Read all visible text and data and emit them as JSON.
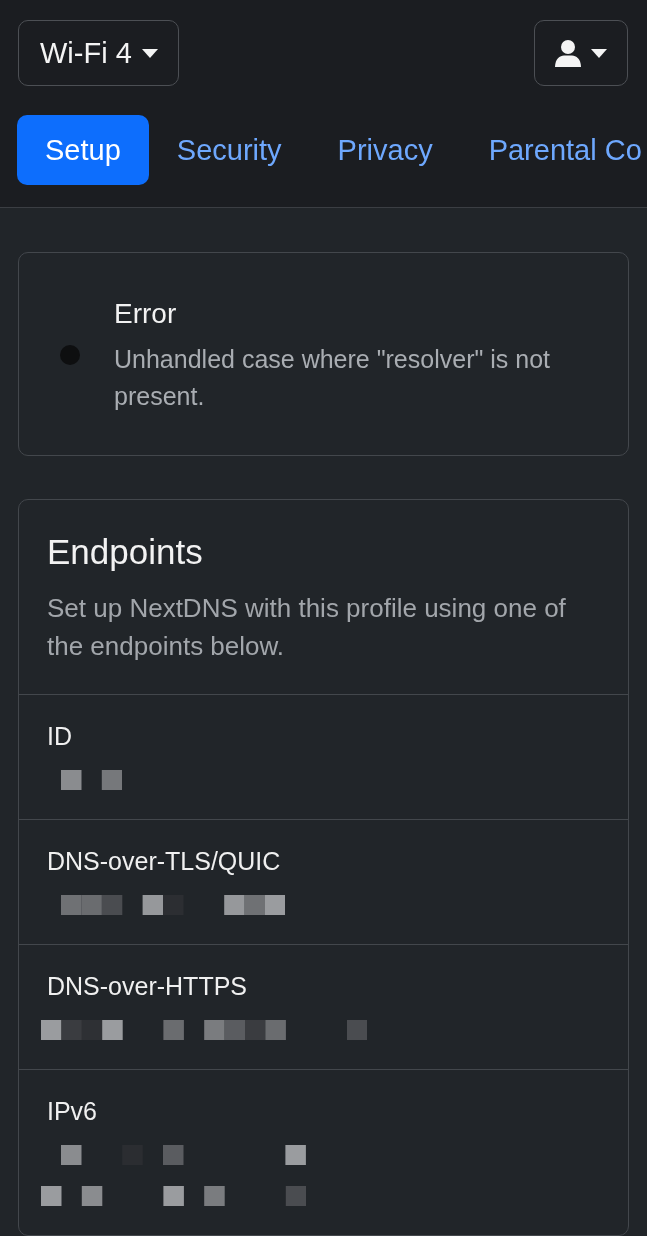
{
  "profile_menu": {
    "label": "Wi-Fi 4"
  },
  "tabs": [
    {
      "label": "Setup",
      "selected": true
    },
    {
      "label": "Security",
      "selected": false
    },
    {
      "label": "Privacy",
      "selected": false
    },
    {
      "label": "Parental Co",
      "selected": false
    }
  ],
  "alert": {
    "title": "Error",
    "message": "Unhandled case where \"resolver\" is not present."
  },
  "endpoints": {
    "title": "Endpoints",
    "description": "Set up NextDNS with this profile using one of the endpoints below.",
    "items": [
      {
        "label": "ID",
        "values": [
          {
            "redacted": true
          }
        ]
      },
      {
        "label": "DNS-over-TLS/QUIC",
        "values": [
          {
            "redacted": true
          }
        ]
      },
      {
        "label": "DNS-over-HTTPS",
        "values": [
          {
            "redacted": true
          }
        ]
      },
      {
        "label": "IPv6",
        "values": [
          {
            "redacted": true
          },
          {
            "redacted": true
          }
        ]
      }
    ]
  }
}
